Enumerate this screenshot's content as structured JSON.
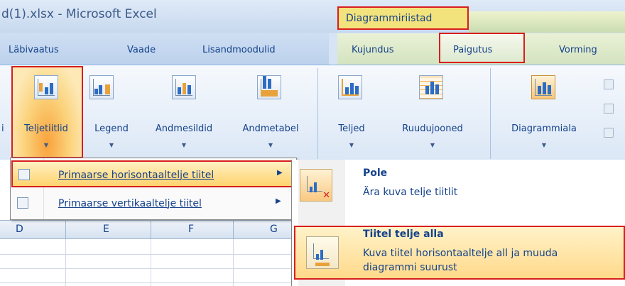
{
  "window": {
    "title": "d(1).xlsx - Microsoft Excel",
    "contextual_tools_label": "Diagrammiriistad"
  },
  "tabs": [
    {
      "label": "Läbivaatus"
    },
    {
      "label": "Vaade"
    },
    {
      "label": "Lisandmoodulid"
    },
    {
      "label": "Kujundus"
    },
    {
      "label": "Paigutus"
    },
    {
      "label": "Vorming"
    }
  ],
  "ribbon": {
    "partial_left_label": "i",
    "buttons": [
      {
        "label": "Teljetiitlid"
      },
      {
        "label": "Legend"
      },
      {
        "label": "Andmesildid"
      },
      {
        "label": "Andmetabel"
      },
      {
        "label": "Teljed"
      },
      {
        "label": "Ruudujooned"
      },
      {
        "label": "Diagrammiala"
      }
    ]
  },
  "menu": {
    "items": [
      {
        "label": "Primaarse horisontaaltelje tiitel"
      },
      {
        "label": "Primaarse vertikaaltelje tiitel"
      }
    ]
  },
  "grid": {
    "columns": [
      "D",
      "E",
      "F",
      "G"
    ]
  },
  "submenu": {
    "items": [
      {
        "title": "Pole",
        "description": "Ära kuva telje tiitlit"
      },
      {
        "title": "Tiitel telje alla",
        "description_line1": "Kuva tiitel horisontaaltelje all ja muuda",
        "description_line2": "diagrammi suurust"
      }
    ]
  },
  "colors": {
    "highlight_border": "#d81e1e",
    "ribbon_text": "#15428b",
    "hover_fill": "#ffd36e"
  }
}
